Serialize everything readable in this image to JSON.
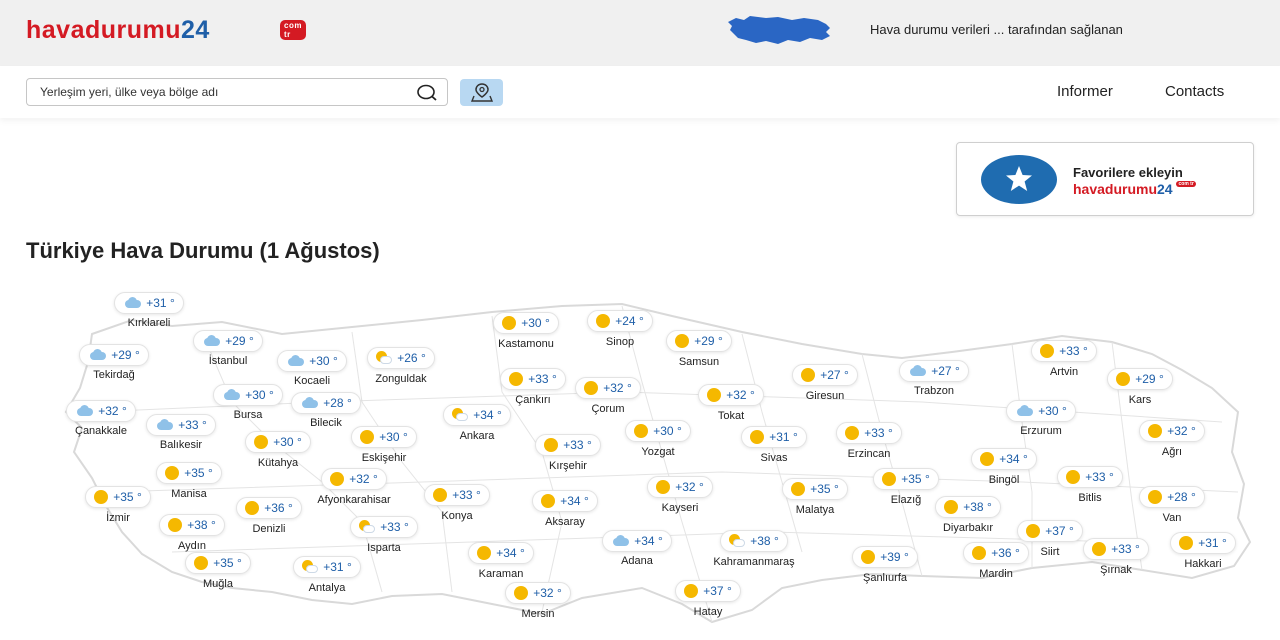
{
  "header": {
    "logo_text": "havadurumu",
    "logo_num": "24",
    "logo_badge": "com tr",
    "provider_text": "Hava durumu verileri ... tarafından sağlanan"
  },
  "nav": {
    "search_placeholder": "Yerleşim yeri, ülke veya bölge adı",
    "links": [
      "Informer",
      "Contacts"
    ]
  },
  "favorite": {
    "title": "Favorilere ekleyin",
    "logo_text": "havadurumu",
    "logo_num": "24",
    "logo_badge": "com tr"
  },
  "page_title": "Türkiye Hava Durumu (1 Ağustos)",
  "colors": {
    "brand_red": "#d41a23",
    "brand_blue": "#1f5fa8",
    "sun": "#f5b800",
    "cloud": "#8fc1e8"
  },
  "cities": [
    {
      "name": "Kırklareli",
      "temp": "+31 °",
      "icon": "cloudy"
    },
    {
      "name": "İstanbul",
      "temp": "+29 °",
      "icon": "cloudy"
    },
    {
      "name": "Tekirdağ",
      "temp": "+29 °",
      "icon": "cloudy"
    },
    {
      "name": "Kocaeli",
      "temp": "+30 °",
      "icon": "cloudy"
    },
    {
      "name": "Zonguldak",
      "temp": "+26 °",
      "icon": "partly-cloudy"
    },
    {
      "name": "Bursa",
      "temp": "+30 °",
      "icon": "cloudy"
    },
    {
      "name": "Bilecik",
      "temp": "+28 °",
      "icon": "cloudy"
    },
    {
      "name": "Çanakkale",
      "temp": "+32 °",
      "icon": "cloudy"
    },
    {
      "name": "Balıkesir",
      "temp": "+33 °",
      "icon": "cloudy"
    },
    {
      "name": "Kütahya",
      "temp": "+30 °",
      "icon": "sunny"
    },
    {
      "name": "Eskişehir",
      "temp": "+30 °",
      "icon": "sunny"
    },
    {
      "name": "Manisa",
      "temp": "+35 °",
      "icon": "sunny"
    },
    {
      "name": "Afyonkarahisar",
      "temp": "+32 °",
      "icon": "sunny"
    },
    {
      "name": "İzmir",
      "temp": "+35 °",
      "icon": "sunny"
    },
    {
      "name": "Denizli",
      "temp": "+36 °",
      "icon": "sunny"
    },
    {
      "name": "Aydın",
      "temp": "+38 °",
      "icon": "sunny"
    },
    {
      "name": "Isparta",
      "temp": "+33 °",
      "icon": "partly-cloudy"
    },
    {
      "name": "Muğla",
      "temp": "+35 °",
      "icon": "sunny"
    },
    {
      "name": "Antalya",
      "temp": "+31 °",
      "icon": "partly-cloudy"
    },
    {
      "name": "Kastamonu",
      "temp": "+30 °",
      "icon": "sunny"
    },
    {
      "name": "Sinop",
      "temp": "+24 °",
      "icon": "sunny"
    },
    {
      "name": "Samsun",
      "temp": "+29 °",
      "icon": "sunny"
    },
    {
      "name": "Çankırı",
      "temp": "+33 °",
      "icon": "sunny"
    },
    {
      "name": "Çorum",
      "temp": "+32 °",
      "icon": "sunny"
    },
    {
      "name": "Ankara",
      "temp": "+34 °",
      "icon": "partly-cloudy"
    },
    {
      "name": "Kırşehir",
      "temp": "+33 °",
      "icon": "sunny"
    },
    {
      "name": "Yozgat",
      "temp": "+30 °",
      "icon": "sunny"
    },
    {
      "name": "Konya",
      "temp": "+33 °",
      "icon": "sunny"
    },
    {
      "name": "Aksaray",
      "temp": "+34 °",
      "icon": "sunny"
    },
    {
      "name": "Karaman",
      "temp": "+34 °",
      "icon": "sunny"
    },
    {
      "name": "Mersin",
      "temp": "+32 °",
      "icon": "sunny"
    },
    {
      "name": "Adana",
      "temp": "+34 °",
      "icon": "cloudy"
    },
    {
      "name": "Kayseri",
      "temp": "+32 °",
      "icon": "sunny"
    },
    {
      "name": "Tokat",
      "temp": "+32 °",
      "icon": "sunny"
    },
    {
      "name": "Sivas",
      "temp": "+31 °",
      "icon": "sunny"
    },
    {
      "name": "Kahramanmaraş",
      "temp": "+38 °",
      "icon": "partly-cloudy"
    },
    {
      "name": "Hatay",
      "temp": "+37 °",
      "icon": "sunny"
    },
    {
      "name": "Giresun",
      "temp": "+27 °",
      "icon": "sunny"
    },
    {
      "name": "Trabzon",
      "temp": "+27 °",
      "icon": "cloudy"
    },
    {
      "name": "Erzincan",
      "temp": "+33 °",
      "icon": "sunny"
    },
    {
      "name": "Malatya",
      "temp": "+35 °",
      "icon": "sunny"
    },
    {
      "name": "Elazığ",
      "temp": "+35 °",
      "icon": "sunny"
    },
    {
      "name": "Şanlıurfa",
      "temp": "+39 °",
      "icon": "sunny"
    },
    {
      "name": "Artvin",
      "temp": "+33 °",
      "icon": "sunny"
    },
    {
      "name": "Kars",
      "temp": "+29 °",
      "icon": "sunny"
    },
    {
      "name": "Erzurum",
      "temp": "+30 °",
      "icon": "cloudy"
    },
    {
      "name": "Ağrı",
      "temp": "+32 °",
      "icon": "sunny"
    },
    {
      "name": "Bingöl",
      "temp": "+34 °",
      "icon": "sunny"
    },
    {
      "name": "Bitlis",
      "temp": "+33 °",
      "icon": "sunny"
    },
    {
      "name": "Van",
      "temp": "+28 °",
      "icon": "sunny"
    },
    {
      "name": "Diyarbakır",
      "temp": "+38 °",
      "icon": "sunny"
    },
    {
      "name": "Siirt",
      "temp": "+37 °",
      "icon": "sunny"
    },
    {
      "name": "Mardin",
      "temp": "+36 °",
      "icon": "sunny"
    },
    {
      "name": "Şırnak",
      "temp": "+33 °",
      "icon": "sunny"
    },
    {
      "name": "Hakkari",
      "temp": "+31 °",
      "icon": "sunny"
    }
  ]
}
